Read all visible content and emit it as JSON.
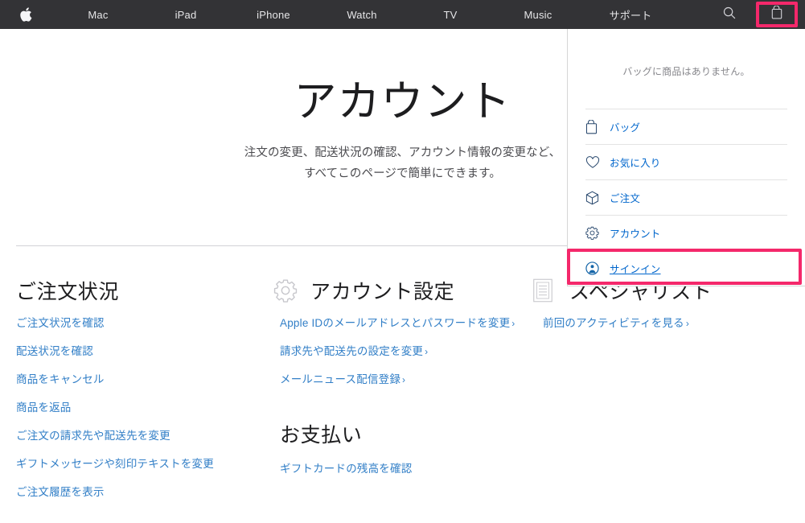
{
  "globalnav": {
    "apple_logo": "apple-logo",
    "items": [
      {
        "label": "Mac",
        "name": "nav-item-mac"
      },
      {
        "label": "iPad",
        "name": "nav-item-ipad"
      },
      {
        "label": "iPhone",
        "name": "nav-item-iphone"
      },
      {
        "label": "Watch",
        "name": "nav-item-watch"
      },
      {
        "label": "TV",
        "name": "nav-item-tv"
      },
      {
        "label": "Music",
        "name": "nav-item-music"
      },
      {
        "label": "サポート",
        "name": "nav-item-support"
      }
    ],
    "search_icon": "search-icon",
    "bag_icon": "shopping-bag-icon",
    "bag_highlight_color": "#f4286b",
    "background_color": "#333336"
  },
  "bag_dropdown": {
    "empty_message": "バッグに商品はありません。",
    "items": [
      {
        "label": "バッグ",
        "icon": "shopping-bag-icon",
        "underlined": false
      },
      {
        "label": "お気に入り",
        "icon": "heart-icon",
        "underlined": false
      },
      {
        "label": "ご注文",
        "icon": "package-box-icon",
        "underlined": false
      },
      {
        "label": "アカウント",
        "icon": "gear-icon",
        "underlined": false
      },
      {
        "label": "サインイン",
        "icon": "person-circle-icon",
        "underlined": true
      }
    ],
    "highlighted_item": "サインイン",
    "highlight_color": "#f4286b",
    "link_color": "#0066cc"
  },
  "hero": {
    "title": "アカウント",
    "subtitle_line1": "注文の変更、配送状況の確認、アカウント情報の変更など、",
    "subtitle_line2": "すべてこのページで簡単にできます。"
  },
  "columns": [
    {
      "name": "order-status",
      "title": "ご注文状況",
      "icon": null,
      "links": [
        {
          "label": "ご注文状況を確認",
          "chevron": false
        },
        {
          "label": "配送状況を確認",
          "chevron": false
        },
        {
          "label": "商品をキャンセル",
          "chevron": false
        },
        {
          "label": "商品を返品",
          "chevron": false
        },
        {
          "label": "ご注文の請求先や配送先を変更",
          "chevron": false
        },
        {
          "label": "ギフトメッセージや刻印テキストを変更",
          "chevron": false
        },
        {
          "label": "ご注文履歴を表示",
          "chevron": false
        }
      ]
    },
    {
      "name": "account-settings",
      "title": "アカウント設定",
      "icon": "gear-icon",
      "links": [
        {
          "label": "Apple IDのメールアドレスとパスワードを変更",
          "chevron": true
        },
        {
          "label": "請求先や配送先の設定を変更",
          "chevron": true
        },
        {
          "label": "メールニュース配信登録",
          "chevron": true
        }
      ],
      "sub_section": {
        "title": "お支払い",
        "links": [
          {
            "label": "ギフトカードの残高を確認",
            "chevron": false
          }
        ]
      }
    },
    {
      "name": "specialist",
      "title": "スペシャリスト",
      "icon": "document-lines-icon",
      "links": [
        {
          "label": "前回のアクティビティを見る",
          "chevron": true
        }
      ]
    }
  ],
  "theme": {
    "link_blue": "#327fc7",
    "text_dark": "#1d1d1f",
    "text_gray": "#86868b",
    "divider": "#d2d2d7",
    "highlight_pink": "#f4286b"
  }
}
